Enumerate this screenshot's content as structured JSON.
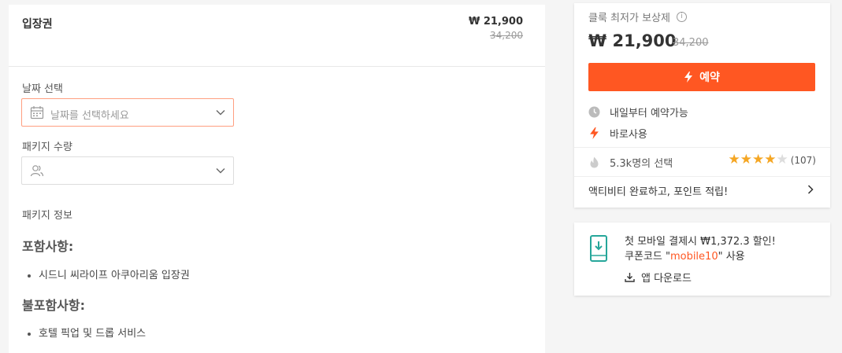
{
  "package": {
    "title": "입장권",
    "price": "₩ 21,900",
    "original_price": "34,200"
  },
  "date_field": {
    "label": "날짜 선택",
    "placeholder": "날짜를 선택하세요"
  },
  "quantity_field": {
    "label": "패키지 수량",
    "value": ""
  },
  "package_info": {
    "label": "패키지 정보",
    "included_heading": "포함사항:",
    "included_items": [
      "시드니 씨라이프 아쿠아리움 입장권"
    ],
    "excluded_heading": "불포함사항:",
    "excluded_items": [
      "호텔 픽업 및 드롭 서비스"
    ]
  },
  "booking_card": {
    "badge": "클룩 최저가 보상제",
    "info_icon": "i",
    "price": "₩ 21,900",
    "original_price": "34,200",
    "book_button": "예약",
    "availability": "내일부터 예약가능",
    "instant_use": "바로사용",
    "booked_count": "5.3k명의 선택",
    "rating": 4,
    "rating_max": 5,
    "review_count": "(107)",
    "points_text": "액티비티 완료하고, 포인트 적립!",
    "accent_color": "#ff5722",
    "star_color": "#f5a623"
  },
  "promo": {
    "line1": "첫 모바일 결제시 ₩1,372.3 할인!",
    "line2_prefix": "쿠폰코드 \"",
    "code": "mobile10",
    "line2_suffix": "\" 사용",
    "download": "앱 다운로드",
    "icon_color": "#26a69a"
  },
  "icons": {
    "date": "calendar-icon",
    "quantity": "people-icon",
    "dropdown": "chevron-down-icon",
    "book": "lightning-icon",
    "availability": "clock-icon",
    "instant": "lightning-icon",
    "booked": "flame-icon",
    "points": "chevron-right-icon",
    "promo": "phone-download-icon",
    "download": "download-icon"
  }
}
